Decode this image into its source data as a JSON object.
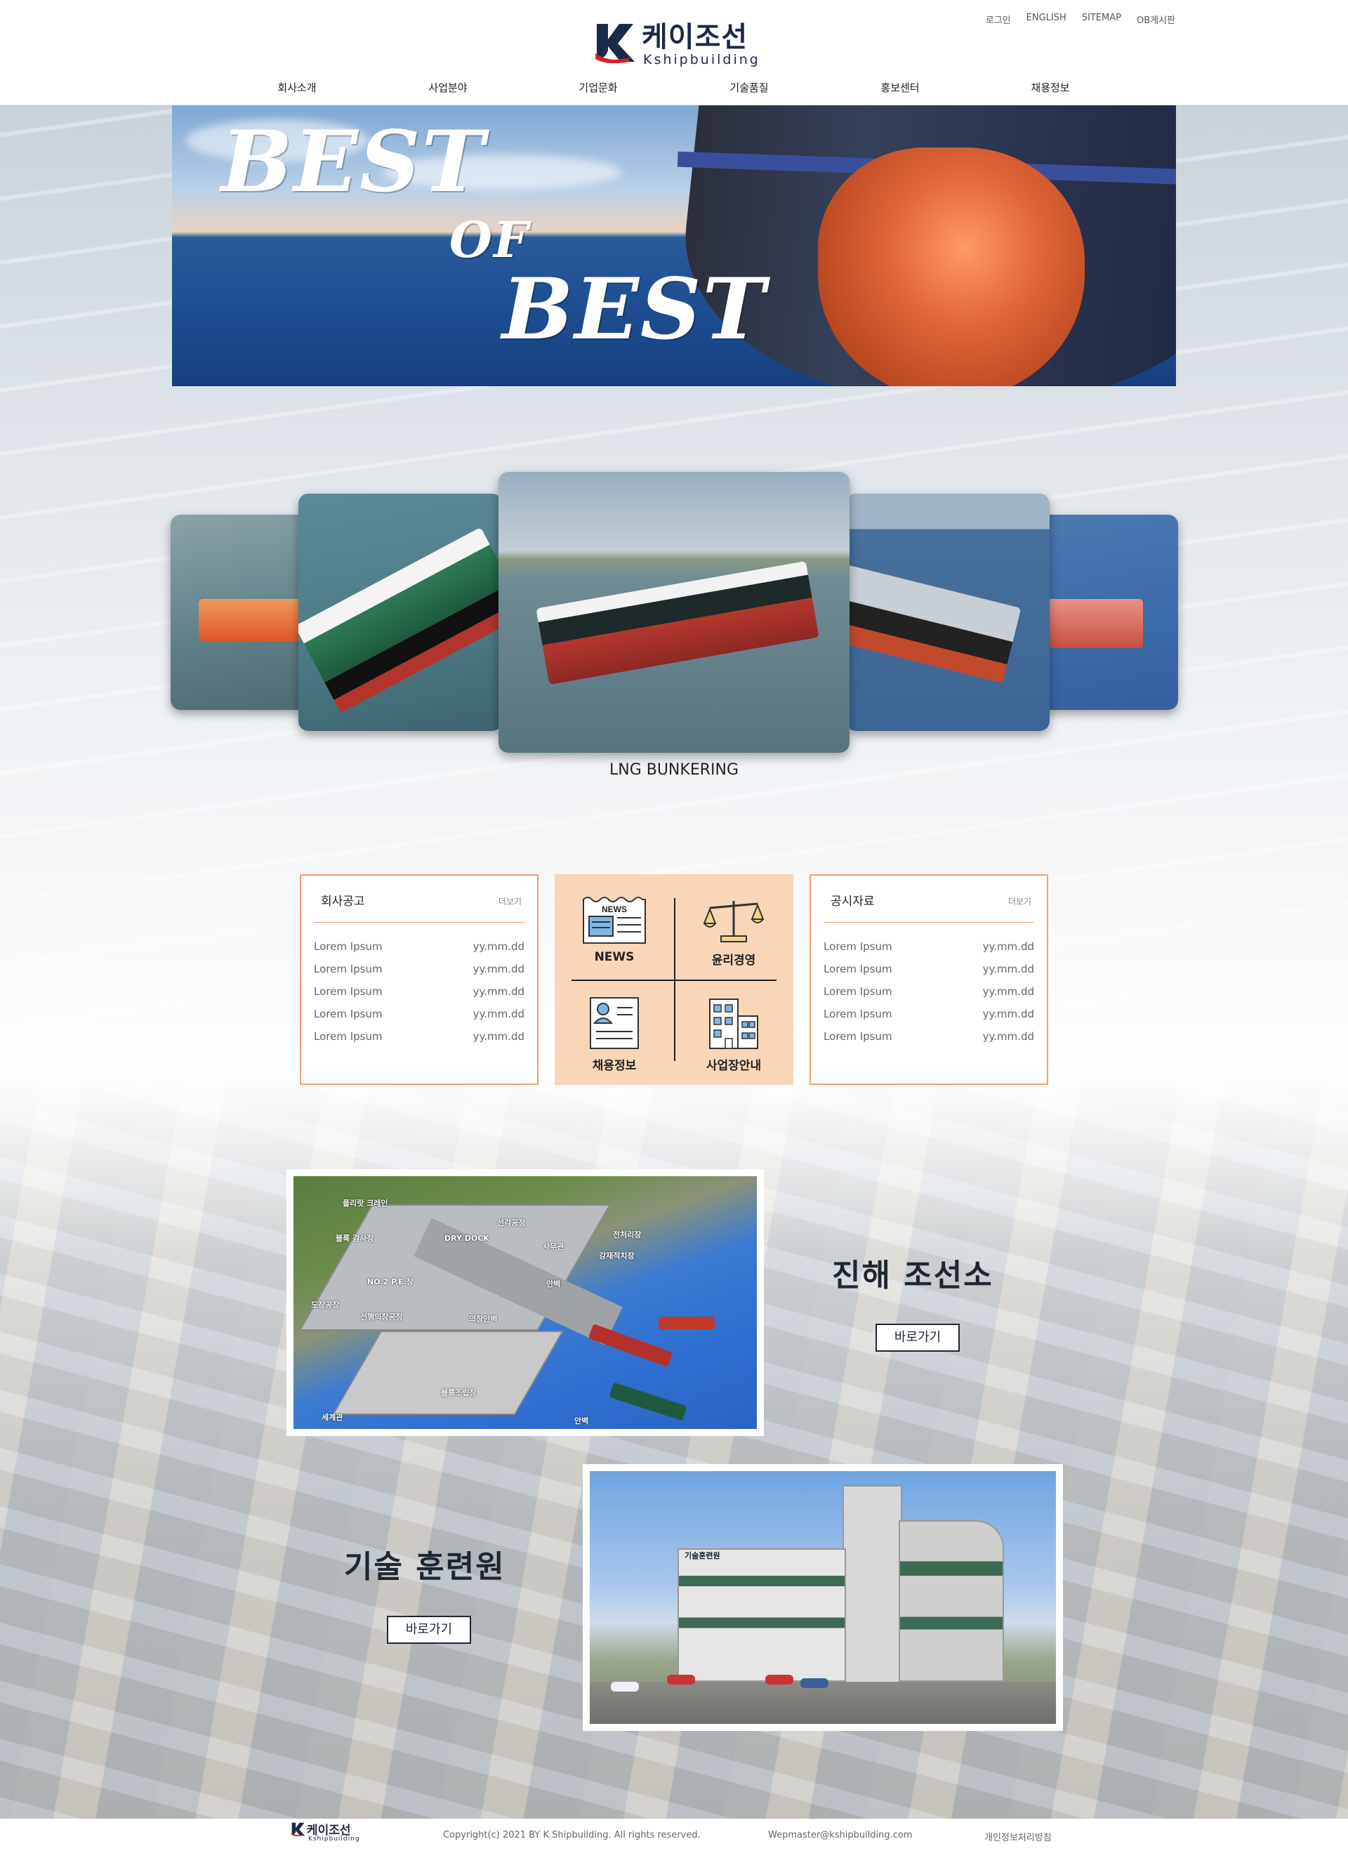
{
  "brand": {
    "name": "케이조선",
    "sub": "Kshipbuilding"
  },
  "util_links": [
    "로그인",
    "ENGLISH",
    "SITEMAP",
    "OB게시판"
  ],
  "nav": [
    "회사소개",
    "사업분야",
    "기업문화",
    "기술품질",
    "홍보센터",
    "채용정보"
  ],
  "banner": {
    "line1": "BEST",
    "line2": "OF",
    "line3": "BEST"
  },
  "carousel": {
    "caption": "LNG BUNKERING"
  },
  "notice": {
    "title": "회사공고",
    "more": "더보기",
    "rows": [
      {
        "t": "Lorem Ipsum",
        "d": "yy.mm.dd"
      },
      {
        "t": "Lorem Ipsum",
        "d": "yy.mm.dd"
      },
      {
        "t": "Lorem Ipsum",
        "d": "yy.mm.dd"
      },
      {
        "t": "Lorem Ipsum",
        "d": "yy.mm.dd"
      },
      {
        "t": "Lorem Ipsum",
        "d": "yy.mm.dd"
      }
    ]
  },
  "quick": {
    "news": "NEWS",
    "ethics": "윤리경영",
    "recruit": "채용정보",
    "site": "사업장안내",
    "news_icon": "NEWS"
  },
  "data_room": {
    "title": "공시자료",
    "more": "더보기",
    "rows": [
      {
        "t": "Lorem Ipsum",
        "d": "yy.mm.dd"
      },
      {
        "t": "Lorem Ipsum",
        "d": "yy.mm.dd"
      },
      {
        "t": "Lorem Ipsum",
        "d": "yy.mm.dd"
      },
      {
        "t": "Lorem Ipsum",
        "d": "yy.mm.dd"
      },
      {
        "t": "Lorem Ipsum",
        "d": "yy.mm.dd"
      }
    ]
  },
  "yard_labels": [
    "블록 검사장",
    "DRY DOCK",
    "선각공장",
    "의장안벽",
    "NO.2 P.E.장",
    "도장공장",
    "선행의장공장",
    "블록조립장",
    "세계관",
    "안벽",
    "전처리장",
    "강재적치장",
    "플리랏 크레인",
    "사무관",
    "안벽"
  ],
  "shipyard": {
    "title": "진해 조선소",
    "button": "바로가기"
  },
  "training": {
    "title": "기술 훈련원",
    "button": "바로가기",
    "sign": "기술훈련원"
  },
  "footer": {
    "brand": "케이조선",
    "sub": "Kshipbuilding",
    "copyright": "Copyright(c) 2021 BY K Shipbuilding. All rights reserved.",
    "email": "Wepmaster@kshipbuilding.com",
    "privacy": "개인정보처리방침"
  },
  "colors": {
    "accent": "#f0a070",
    "quick_bg": "#f9d6b8",
    "navy": "#1b2a48",
    "brand_red": "#d2232a"
  }
}
